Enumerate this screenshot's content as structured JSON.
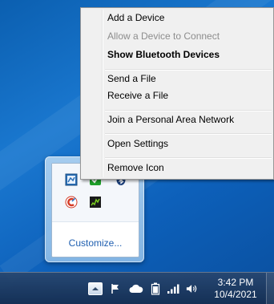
{
  "context_menu": {
    "items": [
      {
        "label": "Add a Device",
        "enabled": true,
        "bold": false
      },
      {
        "label": "Allow a Device to Connect",
        "enabled": false,
        "bold": false
      },
      {
        "label": "Show Bluetooth Devices",
        "enabled": true,
        "bold": true
      },
      {
        "label": "Send a File",
        "enabled": true,
        "bold": false
      },
      {
        "label": "Receive a File",
        "enabled": true,
        "bold": false
      },
      {
        "label": "Join a Personal Area Network",
        "enabled": true,
        "bold": false
      },
      {
        "label": "Open Settings",
        "enabled": true,
        "bold": false
      },
      {
        "label": "Remove Icon",
        "enabled": true,
        "bold": false
      }
    ]
  },
  "tray_overflow": {
    "icons": [
      "network-monitor-icon",
      "security-check-icon",
      "bluetooth-icon",
      "ccleaner-icon",
      "gpu-monitor-icon"
    ],
    "customize_label": "Customize..."
  },
  "taskbar": {
    "tray_icons": [
      "show-hidden-icons-arrow-icon",
      "action-center-flag-icon",
      "onedrive-cloud-icon",
      "battery-icon",
      "network-signal-icon",
      "volume-icon"
    ],
    "clock": {
      "time": "3:42 PM",
      "date": "10/4/2021"
    }
  },
  "colors": {
    "desktop": "#1a78d0",
    "menu_background": "#f0f0f0",
    "link": "#1f5fb0"
  }
}
